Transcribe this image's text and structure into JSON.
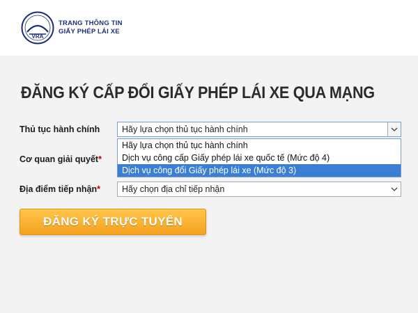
{
  "header": {
    "brand_line1": "TRANG THÔNG TIN",
    "brand_line2": "GIẤY PHÉP LÁI XE",
    "logo_text": "VRA"
  },
  "page_title": "ĐĂNG KÝ CẤP ĐỔI GIẤY PHÉP LÁI XE QUA MẠNG",
  "form": {
    "procedure": {
      "label": "Thủ tục hành chính",
      "value": "Hãy lựa chọn thủ tục hành chính",
      "options": [
        "Hãy lựa chọn thủ tục hành chính",
        "Dịch vụ công cấp Giấy phép lái xe quốc tế (Mức độ 4)",
        "Dịch vụ công đổi Giấy phép lái xe (Mức độ 3)"
      ],
      "highlighted_index": 2
    },
    "agency": {
      "label": "Cơ quan giải quyết",
      "required_mark": "*"
    },
    "location": {
      "label": "Địa điểm tiếp nhận",
      "required_mark": "*",
      "value": "Hãy chọn địa chỉ tiếp nhận"
    }
  },
  "submit_button": "ĐĂNG KÝ TRỰC TUYẾN",
  "colors": {
    "button": "#f7a825",
    "highlight": "#3a7fd4",
    "brand": "#1d2f7a"
  }
}
